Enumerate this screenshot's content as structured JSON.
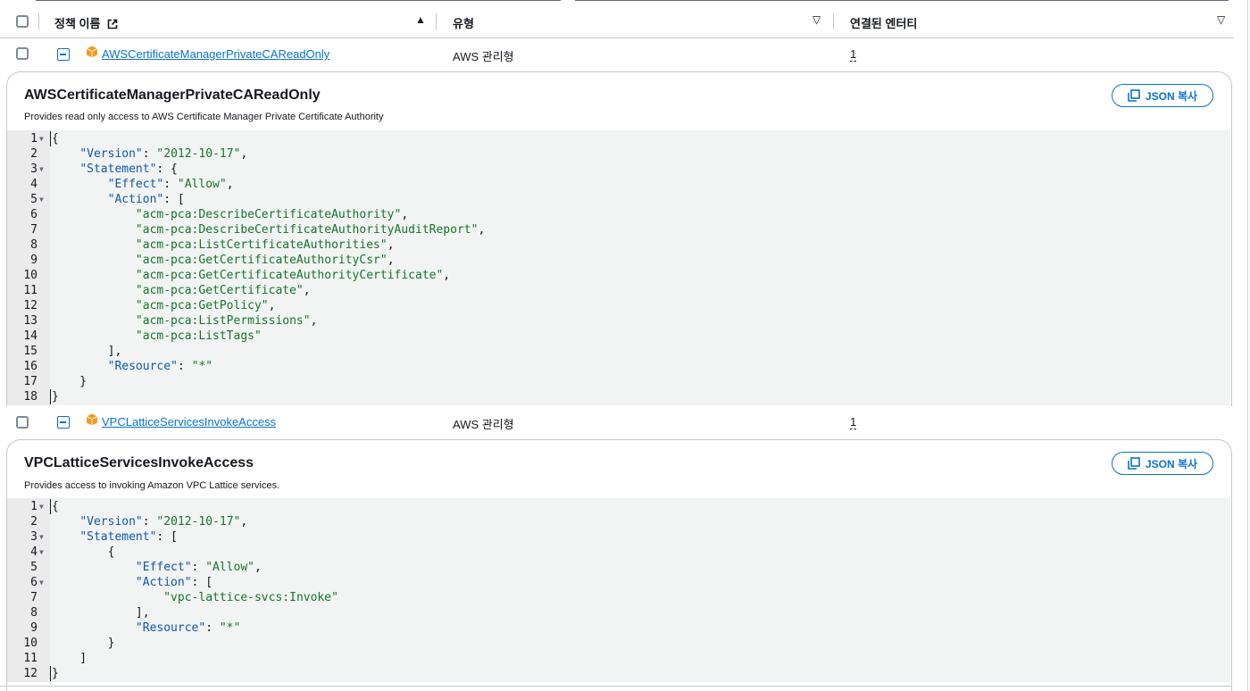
{
  "table": {
    "headers": {
      "name": "정책 이름",
      "type": "유형",
      "entities": "연결된 엔터티"
    }
  },
  "policies": [
    {
      "name": "AWSCertificateManagerPrivateCAReadOnly",
      "type": "AWS 관리형",
      "entities": "1",
      "title": "AWSCertificateManagerPrivateCAReadOnly",
      "description": "Provides read only access to AWS Certificate Manager Private Certificate Authority",
      "copy_label": "JSON 복사",
      "code": [
        {
          "n": "1",
          "fold": true,
          "t": "{"
        },
        {
          "n": "2",
          "fold": false,
          "t": "    \"Version\": \"2012-10-17\","
        },
        {
          "n": "3",
          "fold": true,
          "t": "    \"Statement\": {"
        },
        {
          "n": "4",
          "fold": false,
          "t": "        \"Effect\": \"Allow\","
        },
        {
          "n": "5",
          "fold": true,
          "t": "        \"Action\": ["
        },
        {
          "n": "6",
          "fold": false,
          "t": "            \"acm-pca:DescribeCertificateAuthority\","
        },
        {
          "n": "7",
          "fold": false,
          "t": "            \"acm-pca:DescribeCertificateAuthorityAuditReport\","
        },
        {
          "n": "8",
          "fold": false,
          "t": "            \"acm-pca:ListCertificateAuthorities\","
        },
        {
          "n": "9",
          "fold": false,
          "t": "            \"acm-pca:GetCertificateAuthorityCsr\","
        },
        {
          "n": "10",
          "fold": false,
          "t": "            \"acm-pca:GetCertificateAuthorityCertificate\","
        },
        {
          "n": "11",
          "fold": false,
          "t": "            \"acm-pca:GetCertificate\","
        },
        {
          "n": "12",
          "fold": false,
          "t": "            \"acm-pca:GetPolicy\","
        },
        {
          "n": "13",
          "fold": false,
          "t": "            \"acm-pca:ListPermissions\","
        },
        {
          "n": "14",
          "fold": false,
          "t": "            \"acm-pca:ListTags\""
        },
        {
          "n": "15",
          "fold": false,
          "t": "        ],"
        },
        {
          "n": "16",
          "fold": false,
          "t": "        \"Resource\": \"*\""
        },
        {
          "n": "17",
          "fold": false,
          "t": "    }"
        },
        {
          "n": "18",
          "fold": false,
          "t": "}"
        }
      ]
    },
    {
      "name": "VPCLatticeServicesInvokeAccess",
      "type": "AWS 관리형",
      "entities": "1",
      "title": "VPCLatticeServicesInvokeAccess",
      "description": "Provides access to invoking Amazon VPC Lattice services.",
      "copy_label": "JSON 복사",
      "code": [
        {
          "n": "1",
          "fold": true,
          "t": "{"
        },
        {
          "n": "2",
          "fold": false,
          "t": "    \"Version\": \"2012-10-17\","
        },
        {
          "n": "3",
          "fold": true,
          "t": "    \"Statement\": ["
        },
        {
          "n": "4",
          "fold": true,
          "t": "        {"
        },
        {
          "n": "5",
          "fold": false,
          "t": "            \"Effect\": \"Allow\","
        },
        {
          "n": "6",
          "fold": true,
          "t": "            \"Action\": ["
        },
        {
          "n": "7",
          "fold": false,
          "t": "                \"vpc-lattice-svcs:Invoke\""
        },
        {
          "n": "8",
          "fold": false,
          "t": "            ],"
        },
        {
          "n": "9",
          "fold": false,
          "t": "            \"Resource\": \"*\""
        },
        {
          "n": "10",
          "fold": false,
          "t": "        }"
        },
        {
          "n": "11",
          "fold": false,
          "t": "    ]"
        },
        {
          "n": "12",
          "fold": false,
          "t": "}"
        }
      ]
    }
  ]
}
